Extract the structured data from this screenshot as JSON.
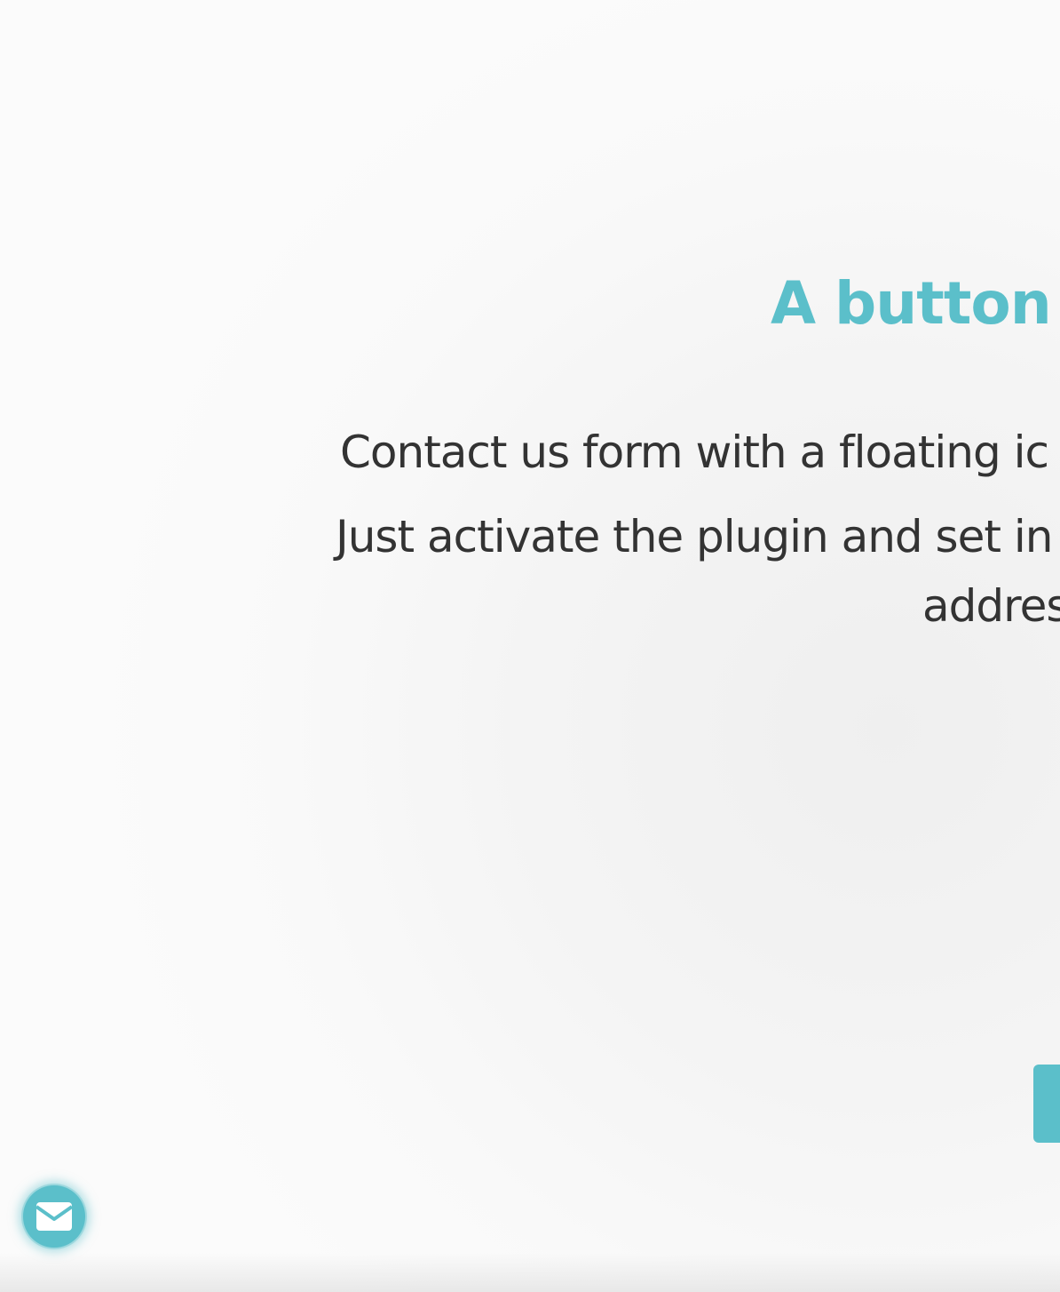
{
  "hero": {
    "headline": "A button t",
    "paragraph_line_1": "Contact us form with a floating ic",
    "paragraph_line_2": "Just activate the plugin and set in",
    "paragraph_line_3": "addres"
  },
  "floating_contact_button": {
    "icon": "envelope-icon"
  },
  "colors": {
    "accent": "#5bbfca",
    "text": "#333333",
    "background": "#f7f7f7"
  }
}
